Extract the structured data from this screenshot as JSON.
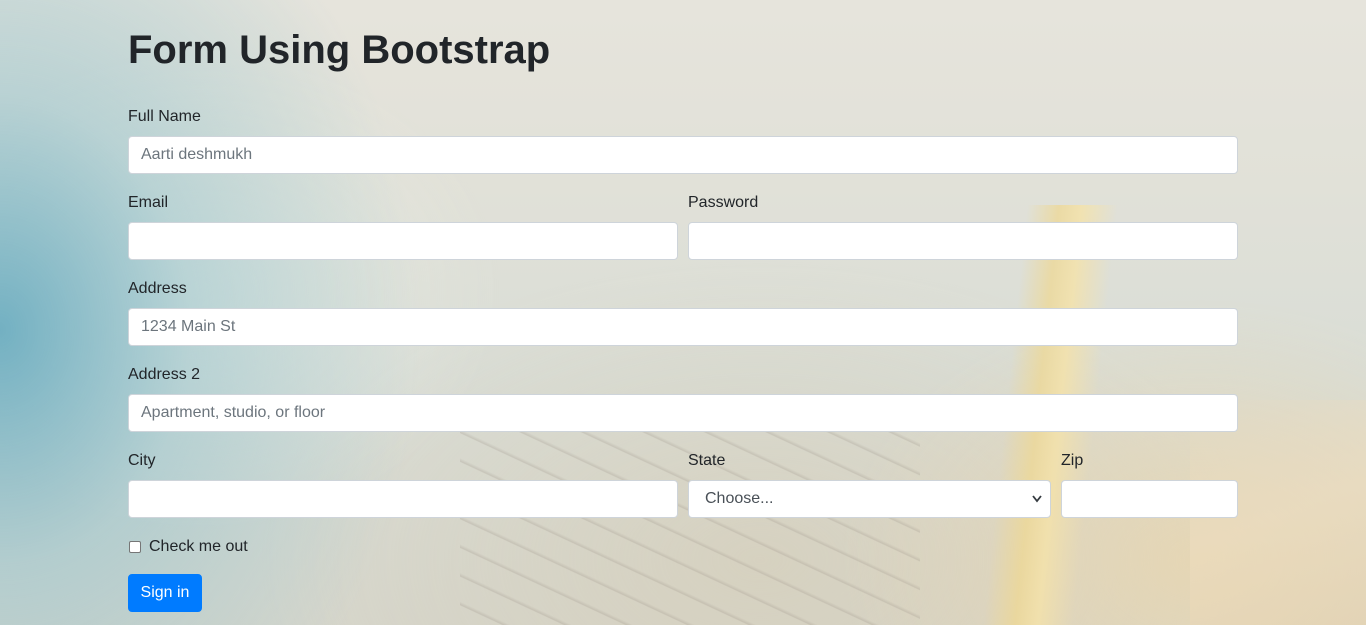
{
  "page": {
    "title": "Form Using Bootstrap"
  },
  "form": {
    "full_name": {
      "label": "Full Name",
      "placeholder": "Aarti deshmukh",
      "value": ""
    },
    "email": {
      "label": "Email",
      "placeholder": "",
      "value": ""
    },
    "password": {
      "label": "Password",
      "placeholder": "",
      "value": ""
    },
    "address": {
      "label": "Address",
      "placeholder": "1234 Main St",
      "value": ""
    },
    "address2": {
      "label": "Address 2",
      "placeholder": "Apartment, studio, or floor",
      "value": ""
    },
    "city": {
      "label": "City",
      "placeholder": "",
      "value": ""
    },
    "state": {
      "label": "State",
      "selected": "Choose..."
    },
    "zip": {
      "label": "Zip",
      "placeholder": "",
      "value": ""
    },
    "checkbox": {
      "label": "Check me out",
      "checked": false
    },
    "submit": {
      "label": "Sign in"
    }
  },
  "colors": {
    "primary": "#007bff",
    "text": "#212529",
    "input_border": "#ced4da",
    "placeholder": "#6c757d"
  },
  "icons": {
    "select_chevron": "chevron-down-icon"
  }
}
